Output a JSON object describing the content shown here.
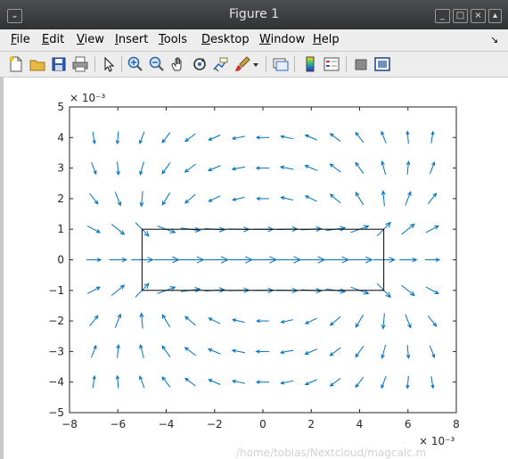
{
  "window": {
    "title": "Figure 1",
    "buttons": [
      "_",
      "□",
      "×"
    ]
  },
  "menu": [
    {
      "label": "File",
      "u": "F",
      "rest": "ile"
    },
    {
      "label": "Edit",
      "u": "E",
      "rest": "dit"
    },
    {
      "label": "View",
      "u": "V",
      "rest": "iew"
    },
    {
      "label": "Insert",
      "u": "I",
      "rest": "nsert"
    },
    {
      "label": "Tools",
      "u": "T",
      "rest": "ools"
    },
    {
      "label": "Desktop",
      "u": "D",
      "rest": "esktop"
    },
    {
      "label": "Window",
      "u": "W",
      "rest": "indow"
    },
    {
      "label": "Help",
      "u": "H",
      "rest": "elp"
    }
  ],
  "toolbar_icons": [
    "new-figure-icon",
    "open-file-icon",
    "save-icon",
    "print-icon",
    "edit-plot-arrow-icon",
    "zoom-in-icon",
    "zoom-out-icon",
    "pan-hand-icon",
    "rotate-3d-icon",
    "data-cursor-icon",
    "brush-icon",
    "link-plot-icon",
    "colorbar-icon",
    "legend-icon",
    "hide-plot-tools-icon",
    "show-plot-tools-icon"
  ],
  "status_text": "/home/tobias/Nextcloud/magcalc.m",
  "chart_data": {
    "type": "quiver",
    "title": "",
    "xlabel": "",
    "ylabel": "",
    "x_exponent_label": "× 10⁻³",
    "y_exponent_label": "× 10⁻³",
    "xlim": [
      -8,
      8
    ],
    "ylim": [
      -5,
      5
    ],
    "x_ticks": [
      -8,
      -6,
      -4,
      -2,
      0,
      2,
      4,
      6,
      8
    ],
    "y_ticks": [
      -5,
      -4,
      -3,
      -2,
      -1,
      0,
      1,
      2,
      3,
      4,
      5
    ],
    "grid": false,
    "arrow_color": "#0072bd",
    "grid_points_x": [
      -7,
      -6,
      -5,
      -4,
      -3,
      -2,
      -1,
      0,
      1,
      2,
      3,
      4,
      5,
      6,
      7
    ],
    "grid_points_y": [
      -4,
      -3,
      -2,
      -1,
      0,
      1,
      2,
      3,
      4
    ],
    "field": "circulating magnetic field around a rectangular current loop (counter-clockwise above, clockwise below)",
    "rectangle": {
      "x": [
        -5,
        5
      ],
      "y": [
        -1,
        1
      ],
      "color": "#000000"
    }
  }
}
